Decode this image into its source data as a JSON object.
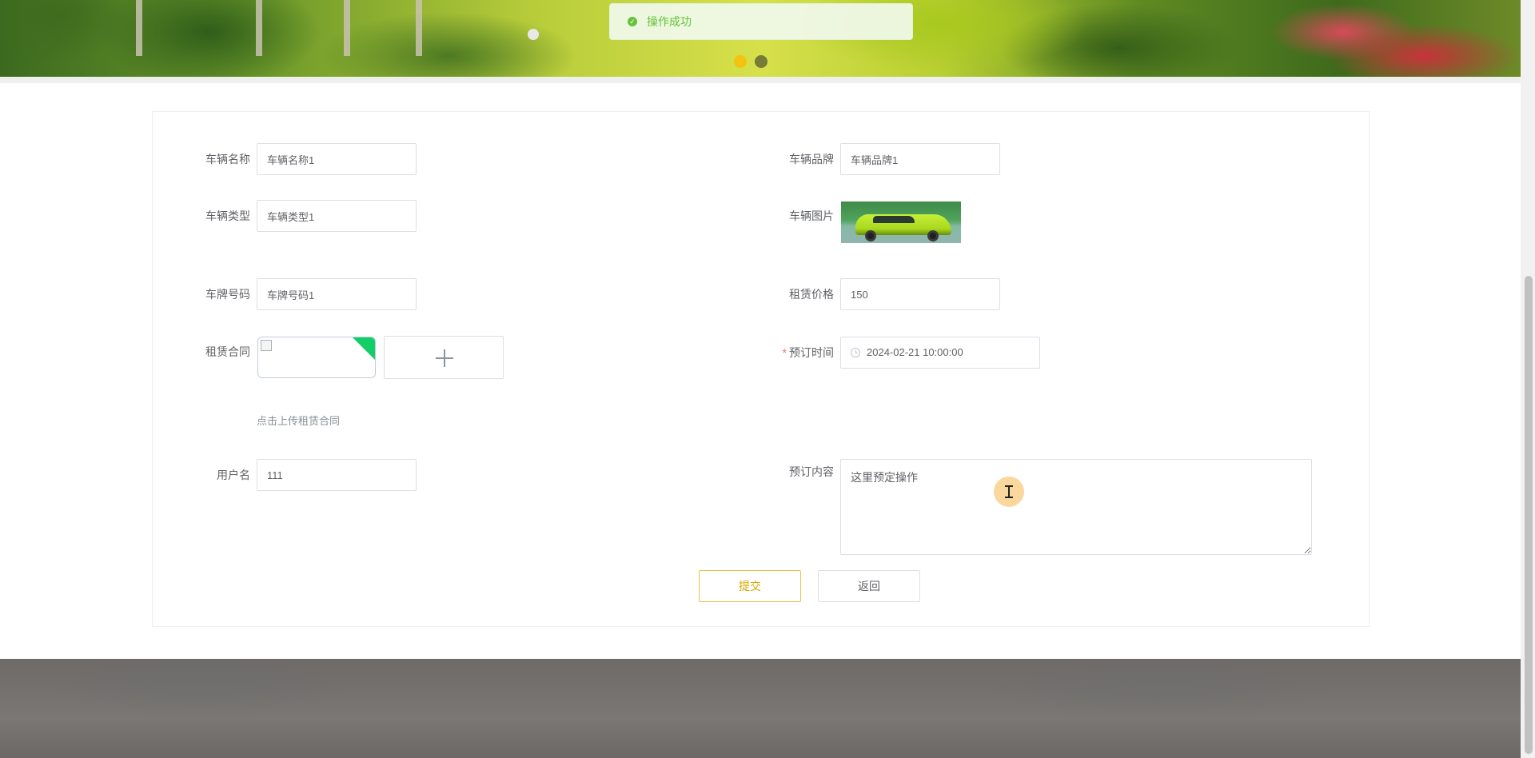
{
  "toast": {
    "message": "操作成功"
  },
  "form": {
    "vehicle_name": {
      "label": "车辆名称",
      "value": "车辆名称1"
    },
    "vehicle_brand": {
      "label": "车辆品牌",
      "value": "车辆品牌1"
    },
    "vehicle_type": {
      "label": "车辆类型",
      "value": "车辆类型1"
    },
    "vehicle_image": {
      "label": "车辆图片"
    },
    "plate_number": {
      "label": "车牌号码",
      "value": "车牌号码1"
    },
    "rental_price": {
      "label": "租赁价格",
      "value": "150"
    },
    "rental_contract": {
      "label": "租赁合同",
      "upload_tip": "点击上传租赁合同"
    },
    "booking_time": {
      "label": "预订时间",
      "required_mark": "*",
      "value": "2024-02-21 10:00:00"
    },
    "username": {
      "label": "用户名",
      "value": "111"
    },
    "booking_content": {
      "label": "预订内容",
      "value": "这里预定操作"
    }
  },
  "buttons": {
    "submit": "提交",
    "back": "返回"
  },
  "carousel": {
    "count": 2,
    "active_index": 0
  },
  "colors": {
    "accent": "#f2c40f",
    "success": "#67c23a",
    "required": "#f56c6c"
  }
}
